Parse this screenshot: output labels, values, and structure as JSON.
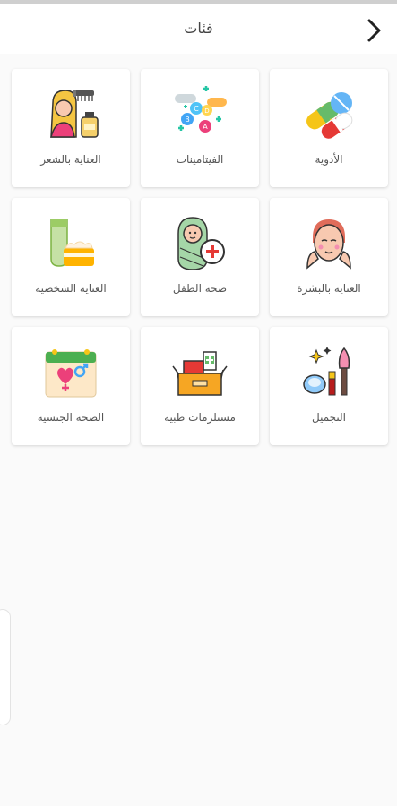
{
  "header": {
    "title": "فئات",
    "back_icon": "chevron-right-icon"
  },
  "categories": [
    {
      "label": "الأدوية",
      "icon": "pills-icon"
    },
    {
      "label": "الفيتامينات",
      "icon": "vitamins-icon"
    },
    {
      "label": "العناية بالشعر",
      "icon": "hair-care-icon"
    },
    {
      "label": "العناية بالبشرة",
      "icon": "skin-care-icon"
    },
    {
      "label": "صحة الطفل",
      "icon": "baby-health-icon"
    },
    {
      "label": "العناية الشخصية",
      "icon": "personal-care-icon"
    },
    {
      "label": "التجميل",
      "icon": "makeup-icon"
    },
    {
      "label": "مستلزمات طبية",
      "icon": "medical-supplies-icon"
    },
    {
      "label": "الصحة الجنسية",
      "icon": "sexual-health-icon"
    }
  ]
}
